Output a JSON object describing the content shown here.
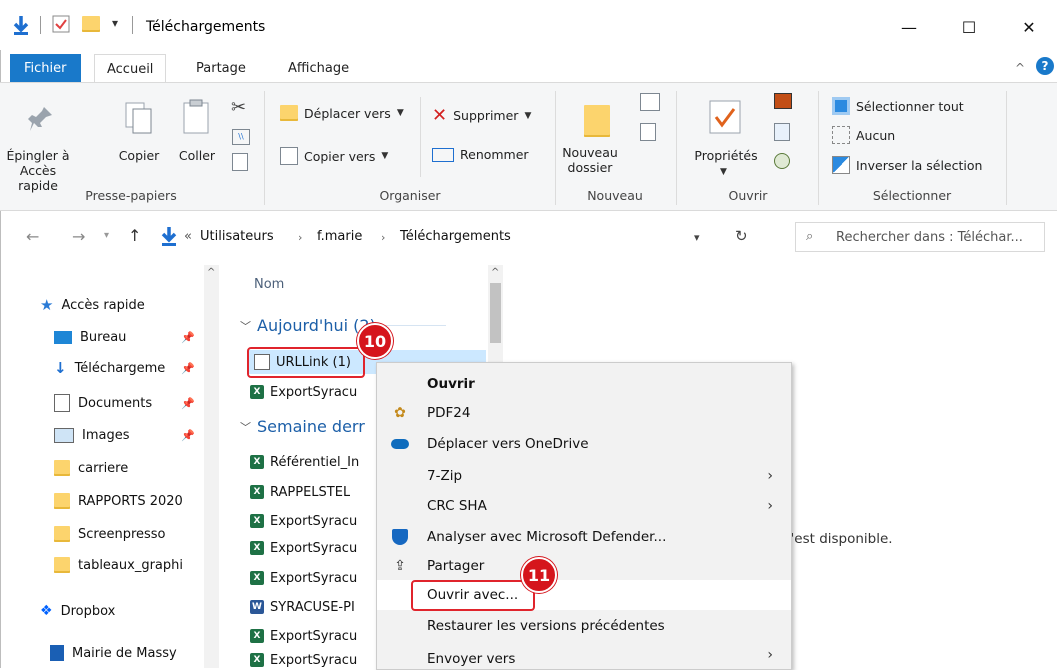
{
  "window": {
    "title": "Téléchargements",
    "minimize": "—",
    "maximize": "☐",
    "close": "✕"
  },
  "menu": {
    "file": "Fichier",
    "tabs": [
      "Accueil",
      "Partage",
      "Affichage"
    ]
  },
  "ribbon": {
    "presse": {
      "pin_line1": "Épingler à",
      "pin_line2": "Accès rapide",
      "copy": "Copier",
      "paste": "Coller",
      "group": "Presse-papiers"
    },
    "organiser": {
      "move": "Déplacer vers",
      "delete": "Supprimer",
      "copy_to": "Copier vers",
      "rename": "Renommer",
      "group": "Organiser"
    },
    "nouveau": {
      "new_folder_line1": "Nouveau",
      "new_folder_line2": "dossier",
      "group": "Nouveau"
    },
    "ouvrir": {
      "properties": "Propriétés",
      "group": "Ouvrir"
    },
    "selectionner": {
      "select_all": "Sélectionner tout",
      "none": "Aucun",
      "invert": "Inverser la sélection",
      "group": "Sélectionner"
    }
  },
  "address": {
    "prefix": "«",
    "crumbs": [
      "Utilisateurs",
      "f.marie",
      "Téléchargements"
    ],
    "search_placeholder": "Rechercher dans : Téléchar..."
  },
  "nav_pane": {
    "quick_access": "Accès rapide",
    "items": [
      {
        "label": "Bureau",
        "pinned": true
      },
      {
        "label": "Téléchargeme",
        "pinned": true
      },
      {
        "label": "Documents",
        "pinned": true
      },
      {
        "label": "Images",
        "pinned": true
      },
      {
        "label": "carriere",
        "pinned": false
      },
      {
        "label": "RAPPORTS 2020",
        "pinned": false
      },
      {
        "label": "Screenpresso",
        "pinned": false
      },
      {
        "label": "tableaux_graphi",
        "pinned": false
      }
    ],
    "dropbox": "Dropbox",
    "mairie": "Mairie de Massy"
  },
  "file_list": {
    "column_name": "Nom",
    "group_today": "Aujourd'hui (2)",
    "group_week": "Semaine derr",
    "today_files": [
      "URLLink (1)",
      "ExportSyracu"
    ],
    "week_files": [
      "Référentiel_In",
      "RAPPELSTEL",
      "ExportSyracu",
      "ExportSyracu",
      "ExportSyracu",
      "SYRACUSE-PI",
      "ExportSyracu",
      "ExportSyracu"
    ],
    "preview_text": "n'est disponible."
  },
  "context_menu": {
    "items": [
      {
        "label": "Ouvrir",
        "bold": true,
        "submenu": false
      },
      {
        "label": "PDF24",
        "submenu": false
      },
      {
        "label": "Déplacer vers OneDrive",
        "submenu": false
      },
      {
        "label": "7-Zip",
        "submenu": true
      },
      {
        "label": "CRC SHA",
        "submenu": true
      },
      {
        "label": "Analyser avec Microsoft Defender...",
        "submenu": false
      },
      {
        "label": "Partager",
        "submenu": false
      },
      {
        "label": "Ouvrir avec...",
        "submenu": false
      },
      {
        "label": "Restaurer les versions précédentes",
        "submenu": false
      },
      {
        "label": "Envoyer vers",
        "submenu": true
      }
    ]
  },
  "annotations": {
    "step_10": "10",
    "step_11": "11"
  },
  "colors": {
    "file_tab": "#1979ca",
    "annotation_red": "#d5151c",
    "group_header": "#1c5fa8"
  }
}
